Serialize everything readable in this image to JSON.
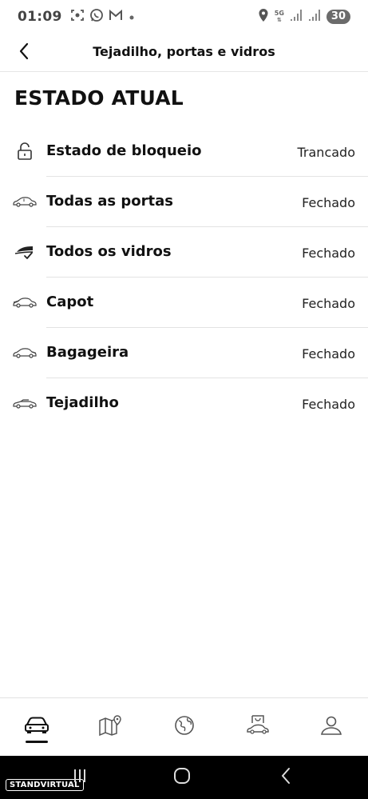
{
  "status_bar": {
    "time": "01:09",
    "network_label": "5G",
    "battery": "30",
    "left_icons": [
      "screenshot-icon",
      "whatsapp-icon",
      "gmail-icon",
      "dot-icon"
    ],
    "right_icons": [
      "location-icon",
      "network-icon",
      "signal-icon",
      "signal-icon"
    ]
  },
  "header": {
    "title": "Tejadilho, portas e vidros",
    "back_icon": "chevron-left-icon"
  },
  "section": {
    "title": "ESTADO ATUAL"
  },
  "rows": [
    {
      "label": "Estado de bloqueio",
      "value": "Trancado",
      "icon": "lock-icon"
    },
    {
      "label": "Todas as portas",
      "value": "Fechado",
      "icon": "car-doors-icon"
    },
    {
      "label": "Todos os vidros",
      "value": "Fechado",
      "icon": "window-check-icon"
    },
    {
      "label": "Capot",
      "value": "Fechado",
      "icon": "car-hood-icon"
    },
    {
      "label": "Bagageira",
      "value": "Fechado",
      "icon": "car-trunk-icon"
    },
    {
      "label": "Tejadilho",
      "value": "Fechado",
      "icon": "car-roof-icon"
    }
  ],
  "bottom_nav": {
    "items": [
      {
        "icon": "car-front-icon",
        "active": true
      },
      {
        "icon": "map-pin-icon",
        "active": false
      },
      {
        "icon": "globe-icon",
        "active": false
      },
      {
        "icon": "car-shop-icon",
        "active": false
      },
      {
        "icon": "profile-icon",
        "active": false
      }
    ]
  },
  "system_nav": {
    "buttons": [
      "recents-icon",
      "home-icon",
      "back-icon"
    ],
    "watermark": "STANDVIRTUAL"
  },
  "colors": {
    "text": "#111111",
    "divider": "#e3e3e3",
    "battery_pill": "#6b6b6b",
    "system_bar": "#000000"
  }
}
